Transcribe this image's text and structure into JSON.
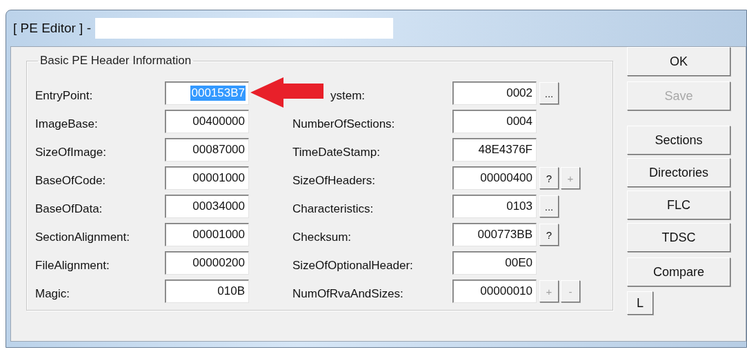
{
  "window": {
    "title": "[ PE Editor ] -"
  },
  "group": {
    "title": "Basic PE Header Information"
  },
  "left_fields": [
    {
      "label": "EntryPoint:",
      "value": "000153B7",
      "highlighted": true
    },
    {
      "label": "ImageBase:",
      "value": "00400000",
      "highlighted": false
    },
    {
      "label": "SizeOfImage:",
      "value": "00087000",
      "highlighted": false
    },
    {
      "label": "BaseOfCode:",
      "value": "00001000",
      "highlighted": false
    },
    {
      "label": "BaseOfData:",
      "value": "00034000",
      "highlighted": false
    },
    {
      "label": "SectionAlignment:",
      "value": "00001000",
      "highlighted": false
    },
    {
      "label": "FileAlignment:",
      "value": "00000200",
      "highlighted": false
    },
    {
      "label": "Magic:",
      "value": "010B",
      "highlighted": false
    }
  ],
  "right_fields": [
    {
      "label": "ystem:",
      "value": "0002",
      "pointer_arrow": true,
      "buttons": [
        {
          "label": "...",
          "disabled": false
        }
      ]
    },
    {
      "label": "NumberOfSections:",
      "value": "0004"
    },
    {
      "label": "TimeDateStamp:",
      "value": "48E4376F"
    },
    {
      "label": "SizeOfHeaders:",
      "value": "00000400",
      "buttons": [
        {
          "label": "?",
          "disabled": false
        },
        {
          "label": "+",
          "disabled": true
        }
      ]
    },
    {
      "label": "Characteristics:",
      "value": "0103",
      "buttons": [
        {
          "label": "...",
          "disabled": false
        }
      ]
    },
    {
      "label": "Checksum:",
      "value": "000773BB",
      "buttons": [
        {
          "label": "?",
          "disabled": false
        }
      ]
    },
    {
      "label": "SizeOfOptionalHeader:",
      "value": "00E0"
    },
    {
      "label": "NumOfRvaAndSizes:",
      "value": "00000010",
      "buttons": [
        {
          "label": "+",
          "disabled": true
        },
        {
          "label": "-",
          "disabled": true
        }
      ]
    }
  ],
  "side_buttons": [
    {
      "label": "OK",
      "disabled": false,
      "kind": "wide"
    },
    {
      "label": "Save",
      "disabled": true,
      "kind": "wide"
    },
    {
      "label": "Sections",
      "disabled": false,
      "kind": "wide"
    },
    {
      "label": "Directories",
      "disabled": false,
      "kind": "wide"
    },
    {
      "label": "FLC",
      "disabled": false,
      "kind": "wide"
    },
    {
      "label": "TDSC",
      "disabled": false,
      "kind": "wide"
    },
    {
      "label": "Compare",
      "disabled": false,
      "kind": "wide"
    },
    {
      "label": "L",
      "disabled": false,
      "kind": "small"
    }
  ]
}
